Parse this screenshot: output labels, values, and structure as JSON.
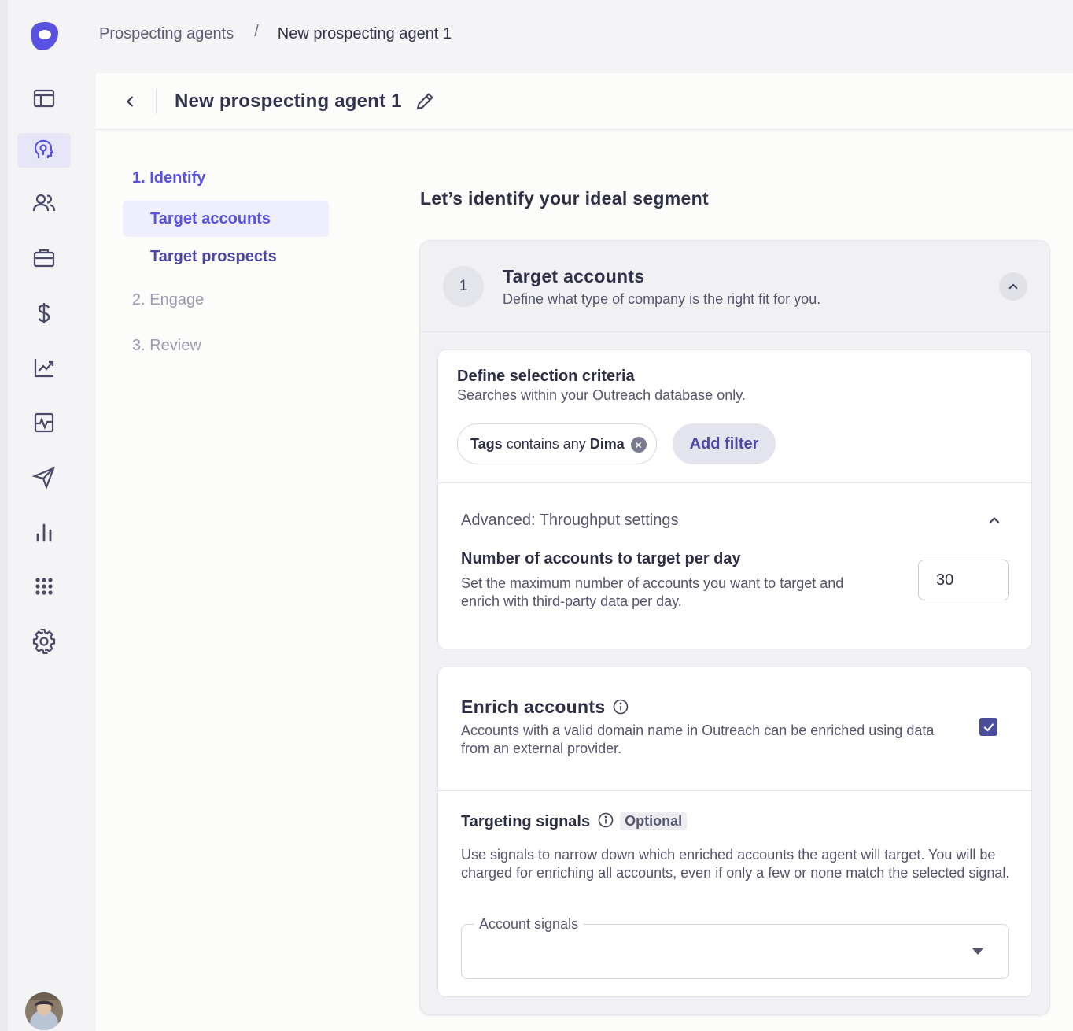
{
  "breadcrumb": {
    "parent": "Prospecting agents",
    "separator": "/",
    "current": "New prospecting agent 1"
  },
  "nav": {
    "items": [
      {
        "icon": "layout-icon"
      },
      {
        "icon": "brain-icon",
        "active": true
      },
      {
        "icon": "people-icon"
      },
      {
        "icon": "briefcase-icon"
      },
      {
        "icon": "dollar-icon"
      },
      {
        "icon": "trending-icon"
      },
      {
        "icon": "pulse-icon"
      },
      {
        "icon": "send-icon"
      },
      {
        "icon": "bar-chart-icon"
      },
      {
        "icon": "apps-grid-icon"
      },
      {
        "icon": "gear-icon"
      }
    ]
  },
  "panel": {
    "title": "New prospecting agent 1"
  },
  "steps": {
    "identify": "1. Identify",
    "target_accounts": "Target accounts",
    "target_prospects": "Target prospects",
    "engage": "2. Engage",
    "review": "3. Review"
  },
  "main": {
    "heading": "Let’s identify your ideal segment",
    "card": {
      "number": "1",
      "title": "Target accounts",
      "subtitle": "Define what type of company is the right fit for you."
    },
    "criteria": {
      "title": "Define selection criteria",
      "subtitle": "Searches within your Outreach database only.",
      "chip_field": "Tags",
      "chip_operator": "contains any",
      "chip_value": "Dima",
      "add_filter": "Add filter"
    },
    "advanced": {
      "title": "Advanced: Throughput settings",
      "setting_title": "Number of accounts to target per day",
      "setting_desc": "Set the maximum number of accounts you want to target and enrich with third-party data per day.",
      "value": "30"
    },
    "enrich": {
      "title": "Enrich accounts",
      "desc": "Accounts with a valid domain name in Outreach can be enriched using data from an external provider.",
      "checked": true
    },
    "signals": {
      "title": "Targeting signals",
      "badge": "Optional",
      "desc": "Use signals to narrow down which enriched accounts the agent will target. You will be charged for enriching all accounts, even if only a few or none match the selected signal.",
      "select_label": "Account signals",
      "select_value": ""
    }
  },
  "colors": {
    "accent": "#5951e0",
    "nav_active_bg": "#e6e6f6",
    "checkbox": "#4c4c9c"
  }
}
